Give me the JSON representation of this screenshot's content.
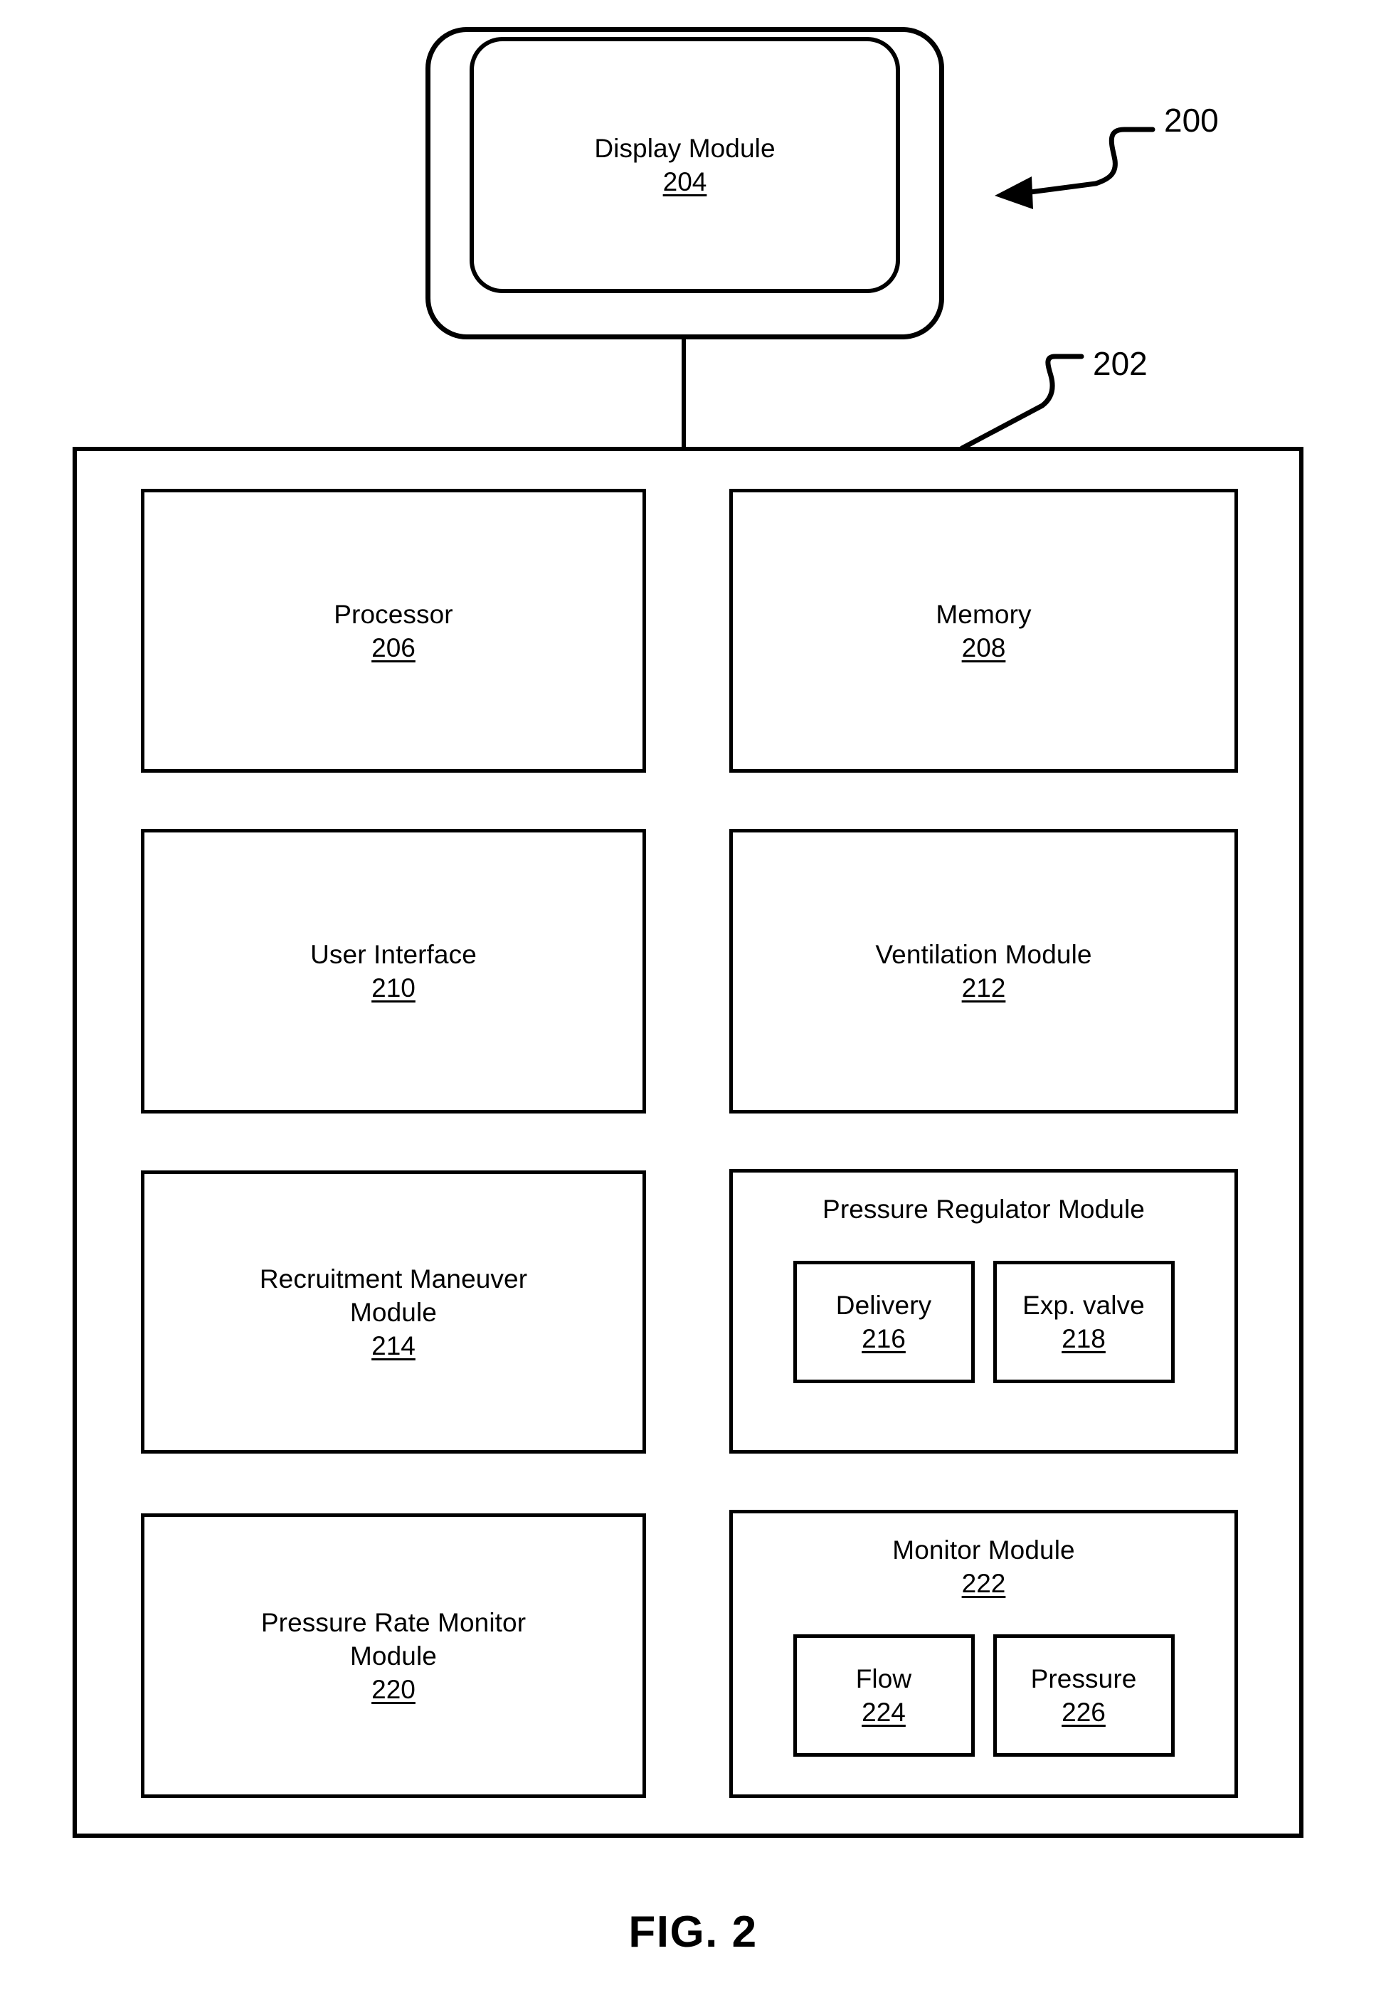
{
  "figure": {
    "caption": "FIG. 2",
    "callouts": [
      {
        "id": "200",
        "label": "200",
        "target": "system-overview-arrow"
      },
      {
        "id": "202",
        "label": "202",
        "target": "ventilator-controller-box"
      }
    ]
  },
  "display_module": {
    "title": "Display Module",
    "ref": "204"
  },
  "controller": {
    "ref": "202",
    "modules": [
      {
        "title": "Processor",
        "ref": "206"
      },
      {
        "title": "Memory",
        "ref": "208"
      },
      {
        "title": "User Interface",
        "ref": "210"
      },
      {
        "title": "Ventilation Module",
        "ref": "212"
      },
      {
        "title": "Recruitment Maneuver\nModule",
        "ref": "214"
      },
      {
        "title": "Pressure Regulator Module",
        "ref": "",
        "sub_modules": [
          {
            "title": "Delivery",
            "ref": "216"
          },
          {
            "title": "Exp. valve",
            "ref": "218"
          }
        ]
      },
      {
        "title": "Pressure Rate Monitor\nModule",
        "ref": "220"
      },
      {
        "title": "Monitor Module",
        "ref": "222",
        "sub_modules": [
          {
            "title": "Flow",
            "ref": "224"
          },
          {
            "title": "Pressure",
            "ref": "226"
          }
        ]
      }
    ]
  }
}
